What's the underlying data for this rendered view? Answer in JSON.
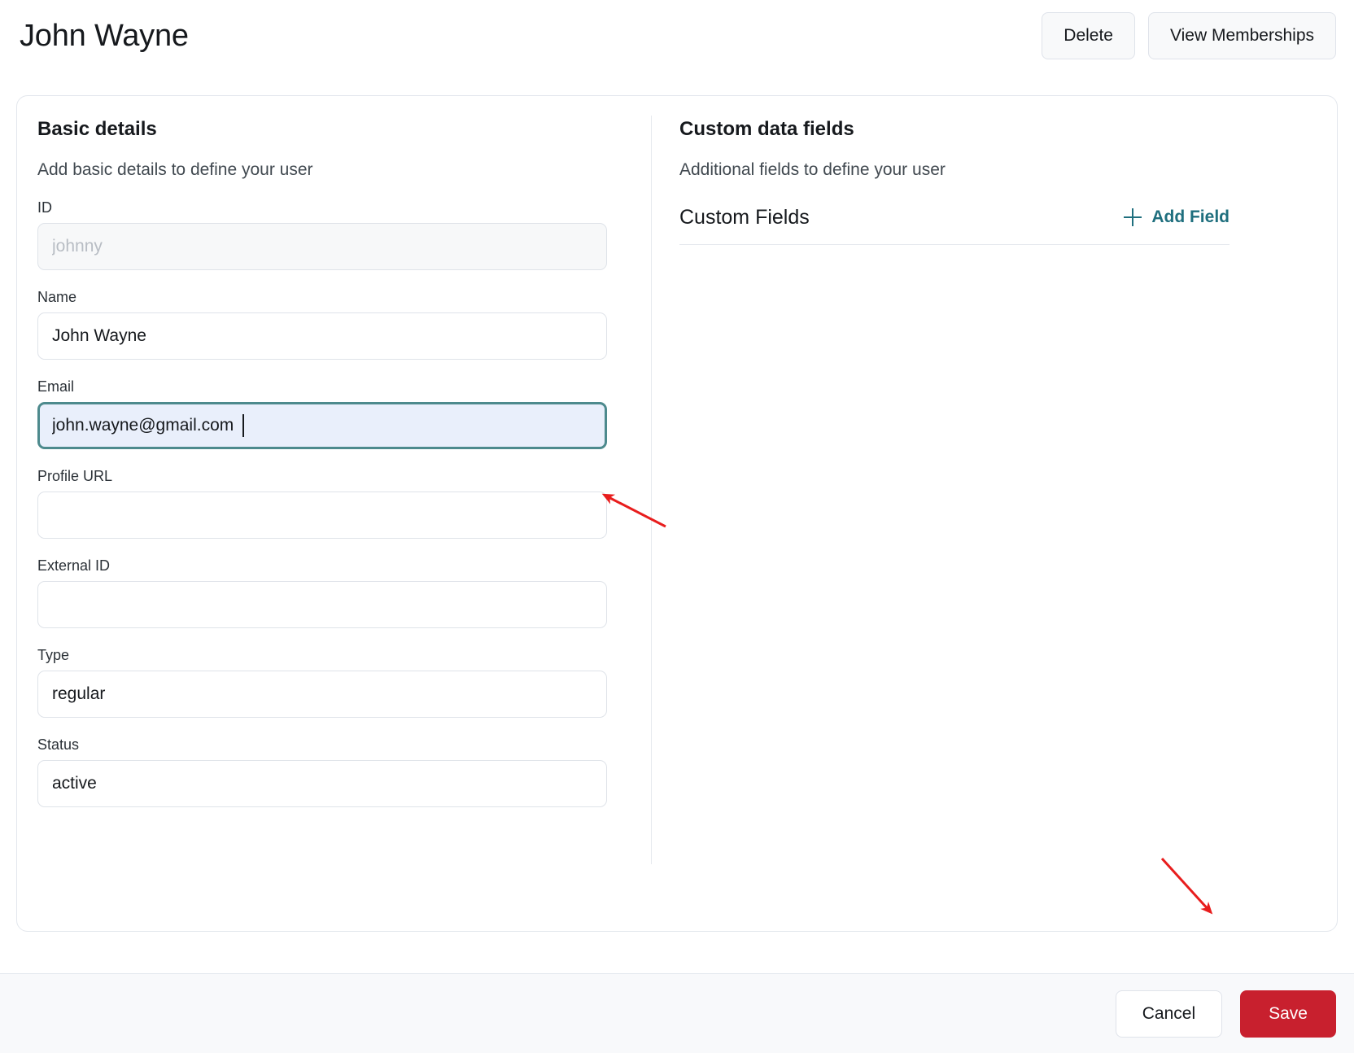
{
  "header": {
    "title": "John Wayne",
    "delete_label": "Delete",
    "view_memberships_label": "View Memberships"
  },
  "basic_details": {
    "title": "Basic details",
    "subtitle": "Add basic details to define your user",
    "fields": [
      {
        "label": "ID",
        "value": "",
        "placeholder": "johnny",
        "state": "disabled"
      },
      {
        "label": "Name",
        "value": "John Wayne",
        "placeholder": "",
        "state": "normal"
      },
      {
        "label": "Email",
        "value": "john.wayne@gmail.com",
        "placeholder": "",
        "state": "focused"
      },
      {
        "label": "Profile URL",
        "value": "",
        "placeholder": "",
        "state": "normal"
      },
      {
        "label": "External ID",
        "value": "",
        "placeholder": "",
        "state": "normal"
      },
      {
        "label": "Type",
        "value": "regular",
        "placeholder": "",
        "state": "normal"
      },
      {
        "label": "Status",
        "value": "active",
        "placeholder": "",
        "state": "normal"
      }
    ]
  },
  "custom_data_fields": {
    "title": "Custom data fields",
    "subtitle": "Additional fields to define your user",
    "list_title": "Custom Fields",
    "add_field_label": "Add Field",
    "add_field_icon": "plus-icon",
    "items": []
  },
  "footer": {
    "cancel_label": "Cancel",
    "save_label": "Save"
  },
  "colors": {
    "accent_teal": "#1f6f7e",
    "focus_border": "#4d8a8d",
    "focus_background": "#e9effb",
    "save_red": "#c8202e",
    "annotation_red": "#e81d1d",
    "card_border": "#e3e7ed",
    "footer_background": "#f8f9fb"
  },
  "annotations": [
    {
      "name": "arrow-to-email-field",
      "color": "#e81d1d"
    },
    {
      "name": "arrow-to-save-button",
      "color": "#e81d1d"
    }
  ]
}
